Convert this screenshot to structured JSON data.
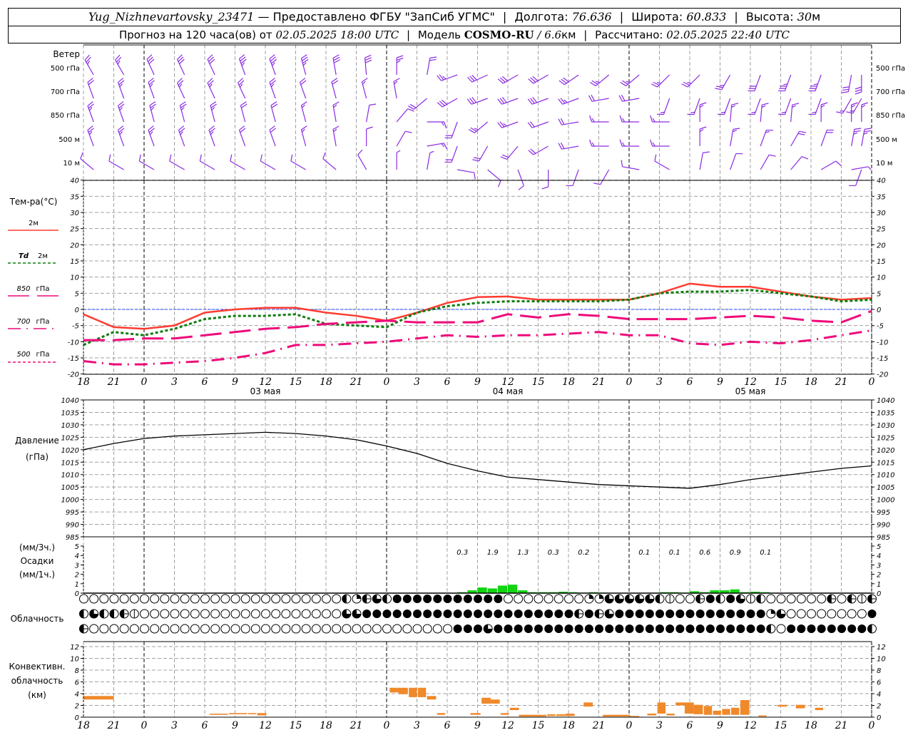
{
  "header": {
    "station": "Yug_Nizhnevartovsky_23471",
    "dash": "—",
    "provided": "Предоставлено ФГБУ \"ЗапСиб УГМС\"",
    "lon_label": "Долгота:",
    "lon": "76.636",
    "lat_label": "Широта:",
    "lat": "60.833",
    "alt_label": "Высота:",
    "alt": "30",
    "alt_unit": "м",
    "forecast_label": "Прогноз на 120 часа(ов) от",
    "forecast_time": "02.05.2025 18:00 UTC",
    "model_label": "Модель",
    "model": "COSMO-RU",
    "model_res": "/ 6.6",
    "model_res_unit": "км",
    "calc_label": "Рассчитано:",
    "calc_time": "02.05.2025 22:40 UTC",
    "sep": "|"
  },
  "labels": {
    "wind": "Ветер",
    "wind_levels": [
      "500 гПа",
      "700 гПа",
      "850 гПа",
      "500  м",
      "10   м"
    ],
    "temp_title": "Тем-ра(°C)",
    "temp_legend": [
      {
        "name": "2м",
        "prefix": ""
      },
      {
        "name": "2м",
        "prefix": "Td"
      },
      {
        "name": "гПа",
        "prefix": "850"
      },
      {
        "name": "гПа",
        "prefix": "700"
      },
      {
        "name": "гПа",
        "prefix": "500"
      }
    ],
    "pressure": "Давление",
    "pressure_unit": "(гПа)",
    "precip_3h": "(мм/3ч.)",
    "precip": "Осадки",
    "precip_1h": "(мм/1ч.)",
    "clouds": "Облачность",
    "conv1": "Конвективн.",
    "conv2": "облачность",
    "conv3": "(км)"
  },
  "colors": {
    "wind": "#8a2be2",
    "t2m": "#ff3b30",
    "td2m": "#0b7d0b",
    "iso": "#ee0a7a",
    "zero": "#1f3fff",
    "pressure": "#000000",
    "precip": "#11d411",
    "conv": "#f0892a",
    "grid": "#a0a0a0"
  },
  "chart_data": [
    {
      "type": "barbs",
      "title": "Ветер",
      "x_hours": "0..78 step 3 from 02.05 18 UTC",
      "levels": [
        {
          "name": "500 гПа",
          "dir": [
            330,
            330,
            335,
            335,
            335,
            340,
            340,
            345,
            350,
            355,
            0,
            10,
            250,
            245,
            240,
            240,
            235,
            230,
            230,
            225,
            225,
            210,
            200,
            200,
            200,
            190,
            180
          ],
          "speed_kt": [
            25,
            25,
            30,
            30,
            30,
            35,
            35,
            35,
            30,
            30,
            25,
            20,
            25,
            30,
            30,
            30,
            30,
            25,
            25,
            25,
            25,
            25,
            30,
            35,
            35,
            30,
            30
          ]
        },
        {
          "name": "700 гПа",
          "dir": [
            340,
            340,
            340,
            335,
            335,
            335,
            340,
            340,
            345,
            345,
            350,
            230,
            240,
            250,
            250,
            250,
            250,
            260,
            260,
            200,
            200,
            200,
            200,
            200,
            200,
            210,
            210
          ],
          "speed_kt": [
            20,
            25,
            25,
            25,
            25,
            25,
            25,
            20,
            20,
            15,
            15,
            20,
            30,
            30,
            30,
            30,
            25,
            20,
            20,
            15,
            15,
            15,
            15,
            15,
            15,
            15,
            15
          ]
        },
        {
          "name": "850 гПа",
          "dir": [
            340,
            340,
            345,
            345,
            345,
            345,
            345,
            345,
            350,
            10,
            40,
            90,
            200,
            230,
            250,
            250,
            260,
            270,
            270,
            270,
            0,
            5,
            5,
            5,
            0,
            0,
            0
          ],
          "speed_kt": [
            25,
            25,
            25,
            25,
            25,
            20,
            20,
            15,
            15,
            10,
            10,
            15,
            20,
            25,
            25,
            20,
            20,
            15,
            15,
            15,
            15,
            15,
            15,
            15,
            15,
            15,
            15
          ]
        },
        {
          "name": "500 м",
          "dir": [
            340,
            340,
            340,
            340,
            340,
            340,
            340,
            345,
            350,
            0,
            30,
            80,
            200,
            210,
            220,
            240,
            260,
            270,
            270,
            270,
            0,
            10,
            20,
            30,
            20,
            10,
            10
          ],
          "speed_kt": [
            25,
            25,
            25,
            25,
            25,
            20,
            20,
            15,
            15,
            10,
            10,
            15,
            20,
            20,
            20,
            20,
            20,
            15,
            15,
            15,
            15,
            15,
            15,
            20,
            20,
            25,
            25
          ]
        },
        {
          "name": "10 м",
          "dir": [
            310,
            300,
            300,
            300,
            300,
            300,
            300,
            300,
            310,
            330,
            0,
            10,
            100,
            130,
            160,
            180,
            200,
            210,
            280,
            300,
            10,
            20,
            30,
            40,
            60,
            80,
            200
          ],
          "speed_kt": [
            10,
            10,
            10,
            10,
            10,
            10,
            10,
            10,
            10,
            10,
            5,
            5,
            10,
            10,
            10,
            10,
            10,
            10,
            10,
            10,
            10,
            10,
            10,
            10,
            10,
            5,
            10
          ]
        }
      ]
    },
    {
      "type": "line",
      "title": "Тем-ра(°C)",
      "ylim": [
        -20,
        40
      ],
      "yticks": [
        -20,
        -15,
        -10,
        -5,
        0,
        5,
        10,
        15,
        20,
        25,
        30,
        35,
        40
      ],
      "x_hours": [
        0,
        3,
        6,
        9,
        12,
        15,
        18,
        21,
        24,
        27,
        30,
        33,
        36,
        39,
        42,
        45,
        48,
        51,
        54,
        57,
        60,
        63,
        66,
        69,
        72,
        75,
        78
      ],
      "series": [
        {
          "name": "2м",
          "values": [
            -1.5,
            -5.5,
            -6,
            -5,
            -1,
            0,
            0.5,
            0.5,
            -1,
            -2,
            -3.5,
            -1,
            2,
            3.8,
            4,
            3,
            3,
            3,
            3,
            5,
            8,
            7,
            7,
            5.5,
            4,
            3,
            3.5
          ]
        },
        {
          "name": "Td 2м",
          "values": [
            -11,
            -7,
            -8,
            -6,
            -3,
            -2,
            -2,
            -1.5,
            -4.5,
            -5,
            -5.5,
            -1,
            1,
            2,
            2.5,
            2.5,
            2.5,
            2.5,
            3,
            5,
            5.5,
            5.5,
            6,
            5,
            4,
            2.5,
            3
          ]
        },
        {
          "name": "850 гПа",
          "values": [
            -9.5,
            -9.5,
            -9,
            -9,
            -8,
            -7,
            -6,
            -5.5,
            -4.5,
            -4,
            -3.5,
            -4,
            -4,
            -4,
            -1.5,
            -2.5,
            -1.5,
            -2,
            -3,
            -3,
            -3,
            -2.5,
            -2,
            -2.5,
            -3.5,
            -4,
            -0.5
          ]
        },
        {
          "name": "700 гПа",
          "values": [
            -9.5,
            -10,
            -9.5,
            -9.5,
            -9,
            -8,
            -6.5,
            -5.5,
            -4.5,
            -4,
            -3.5,
            -3.5,
            -4,
            -3.5,
            -2,
            -2.5,
            -1.5,
            -2,
            -3.5,
            -3,
            -3,
            -2.5,
            -2.5,
            -2.5,
            -3,
            -4,
            -1
          ]
        },
        {
          "name": "500 гПа",
          "values": [
            -16,
            -17,
            -17,
            -16.5,
            -16,
            -15,
            -13.5,
            -11,
            -11,
            -10.5,
            -10,
            -9,
            -8,
            -8.5,
            -8,
            -8,
            -7.5,
            -7,
            -8,
            -8,
            -10.5,
            -11,
            -10,
            -10.5,
            -9.5,
            -8,
            -6.5
          ]
        }
      ]
    },
    {
      "type": "line",
      "title": "Давление (гПа)",
      "ylim": [
        985,
        1040
      ],
      "yticks": [
        985,
        990,
        995,
        1000,
        1005,
        1010,
        1015,
        1020,
        1025,
        1030,
        1035,
        1040
      ],
      "x_hours": [
        0,
        3,
        6,
        9,
        12,
        15,
        18,
        21,
        24,
        27,
        30,
        33,
        36,
        39,
        42,
        45,
        48,
        51,
        54,
        57,
        60,
        63,
        66,
        69,
        72,
        75,
        78
      ],
      "values": [
        1020,
        1022.5,
        1024.5,
        1025.5,
        1026,
        1026.5,
        1027,
        1026.5,
        1025.5,
        1024,
        1021.5,
        1018.5,
        1014.5,
        1011.5,
        1009,
        1008,
        1007,
        1006,
        1005.5,
        1005,
        1004.5,
        1006,
        1008,
        1009.5,
        1011,
        1012.5,
        1013.5
      ]
    },
    {
      "type": "bar",
      "title": "Осадки",
      "ylim": [
        0,
        5.5
      ],
      "yticks": [
        0,
        1,
        2,
        3,
        4,
        5
      ],
      "hourly_hours": [
        37,
        38,
        39,
        40,
        41,
        42,
        43,
        44,
        45,
        46,
        47,
        48,
        49,
        50,
        51,
        56,
        57,
        58,
        59,
        60,
        61,
        62,
        63,
        64,
        65,
        66,
        67
      ],
      "hourly_mm": [
        0.1,
        0.3,
        0.6,
        0.5,
        0.8,
        0.9,
        0.3,
        0.1,
        0.1,
        0.1,
        0.15,
        0.1,
        0.05,
        0.1,
        0.05,
        0.05,
        0.1,
        0.1,
        0.05,
        0.2,
        0.1,
        0.3,
        0.3,
        0.4,
        0.1,
        0.15,
        0.1
      ],
      "sum3h_start_hours": [
        36,
        39,
        42,
        45,
        48,
        51,
        54,
        57,
        60,
        63,
        66
      ],
      "sum3h_labels": [
        "0.3",
        "1.9",
        "1.3",
        "0.3",
        "0.2",
        "",
        "0.1",
        "0.1",
        "0.6",
        "0.9",
        "0.1"
      ]
    },
    {
      "type": "symbols",
      "title": "Облачность",
      "legend": "0 ясно, 1 вертикальная линия, 2 четверть, 4 половина, 5 половина с линией, 6 три четверти, 8 сплошная",
      "rows": [
        "0000000000000000000000000042564888888888880000000022666664100584861400000050515",
        "4644510000000000000000000066888888888888888888888585688888888888888826000000008",
        "5000000000000000000000000000000000000888688888888888888888888888888840888888884"
      ]
    },
    {
      "type": "bar",
      "title": "Конвективн. облачность (км)",
      "ylim": [
        0,
        13
      ],
      "yticks": [
        0,
        2,
        4,
        6,
        8,
        10,
        12
      ],
      "segments_hours_base_top_km": [
        [
          0,
          3,
          3.0,
          3.6
        ],
        [
          12.5,
          14.3,
          0.4,
          0.6
        ],
        [
          14.4,
          16.2,
          0.5,
          0.7
        ],
        [
          16.3,
          17.1,
          0.5,
          0.7
        ],
        [
          17.2,
          18.1,
          0.3,
          0.7
        ],
        [
          30.3,
          32.1,
          4.2,
          5.0
        ],
        [
          31.2,
          32.1,
          3.9,
          4.8
        ],
        [
          32.2,
          33.0,
          3.4,
          5.0
        ],
        [
          33.1,
          33.9,
          3.4,
          5.0
        ],
        [
          34.0,
          34.9,
          3.0,
          3.6
        ],
        [
          35.0,
          35.8,
          0.4,
          0.7
        ],
        [
          38.3,
          39.3,
          0.4,
          0.7
        ],
        [
          39.4,
          40.3,
          2.3,
          3.3
        ],
        [
          40.3,
          41.2,
          2.3,
          3.0
        ],
        [
          41.3,
          42.1,
          0.4,
          0.7
        ],
        [
          42.2,
          43.1,
          1.2,
          1.6
        ],
        [
          43.1,
          45.8,
          0.1,
          0.4
        ],
        [
          45.9,
          46.7,
          0.2,
          0.5
        ],
        [
          46.8,
          47.7,
          0.2,
          0.5
        ],
        [
          47.7,
          48.6,
          0.2,
          0.6
        ],
        [
          49.5,
          50.4,
          1.8,
          2.5
        ],
        [
          51.4,
          54.1,
          0.1,
          0.4
        ],
        [
          54.1,
          55.0,
          0.1,
          0.2
        ],
        [
          55.8,
          56.7,
          0.3,
          0.6
        ],
        [
          56.8,
          57.6,
          0.6,
          2.5
        ],
        [
          57.7,
          58.5,
          0.3,
          0.6
        ],
        [
          58.6,
          60.4,
          2.0,
          2.5
        ],
        [
          59.5,
          60.4,
          0.6,
          2.0
        ],
        [
          60.4,
          61.3,
          0.5,
          2.1
        ],
        [
          61.4,
          62.2,
          0.4,
          1.9
        ],
        [
          62.3,
          63.1,
          0.4,
          1.1
        ],
        [
          63.2,
          64.0,
          0.4,
          1.4
        ],
        [
          64.1,
          64.9,
          0.4,
          1.6
        ],
        [
          65.0,
          65.9,
          0.4,
          2.9
        ],
        [
          66.8,
          67.6,
          0.1,
          0.3
        ],
        [
          68.7,
          69.6,
          1.8,
          2.1
        ],
        [
          70.5,
          71.4,
          1.5,
          2.1
        ],
        [
          72.4,
          73.2,
          1.2,
          1.6
        ]
      ]
    }
  ],
  "time_axis": {
    "ticks": [
      "18",
      "21",
      "0",
      "3",
      "6",
      "9",
      "12",
      "15",
      "18",
      "21",
      "0",
      "3",
      "6",
      "9",
      "12",
      "15",
      "18",
      "21",
      "0",
      "3",
      "6",
      "9",
      "12",
      "15",
      "18",
      "21",
      "0"
    ],
    "days": [
      {
        "label": "03 мая",
        "hour": 18
      },
      {
        "label": "04 мая",
        "hour": 42
      },
      {
        "label": "05 мая",
        "hour": 66
      }
    ]
  }
}
